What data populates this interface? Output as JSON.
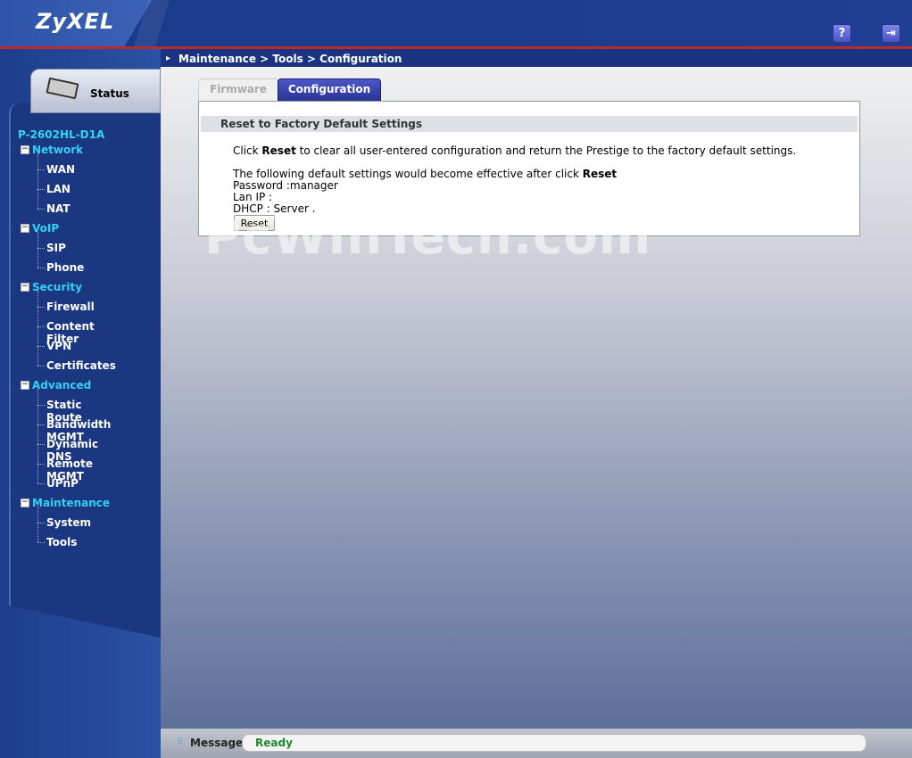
{
  "header": {
    "logo": "ZyXEL",
    "help_icon": "?",
    "logout_icon": "⇥"
  },
  "sidebar": {
    "status_label": "Status",
    "model": "P-2602HL-D1A",
    "sections": [
      {
        "label": "Network",
        "items": [
          "WAN",
          "LAN",
          "NAT"
        ]
      },
      {
        "label": "VoIP",
        "items": [
          "SIP",
          "Phone"
        ]
      },
      {
        "label": "Security",
        "items": [
          "Firewall",
          "Content Filter",
          "VPN",
          "Certificates"
        ]
      },
      {
        "label": "Advanced",
        "items": [
          "Static Route",
          "Bandwidth MGMT",
          "Dynamic DNS",
          "Remote MGMT",
          "UPnP"
        ]
      },
      {
        "label": "Maintenance",
        "items": [
          "System",
          "Tools"
        ]
      }
    ]
  },
  "main": {
    "breadcrumb": "Maintenance > Tools > Configuration",
    "tabs": [
      "Firmware",
      "Configuration"
    ],
    "panel_title": "Reset to Factory Default Settings",
    "line1_a": "Click ",
    "line1_b": "Reset",
    "line1_c": " to clear all user-entered configuration and return the Prestige to the factory default settings.",
    "line2_a": "The following default settings would become effective after click ",
    "line2_b": "Reset",
    "password_line": "Password :manager",
    "lanip_line": "Lan IP : ",
    "dhcp_line": "DHCP : Server .",
    "reset_button": "Reset",
    "watermark": "PcWinTech.com"
  },
  "message": {
    "label": "Message",
    "value": "Ready"
  }
}
